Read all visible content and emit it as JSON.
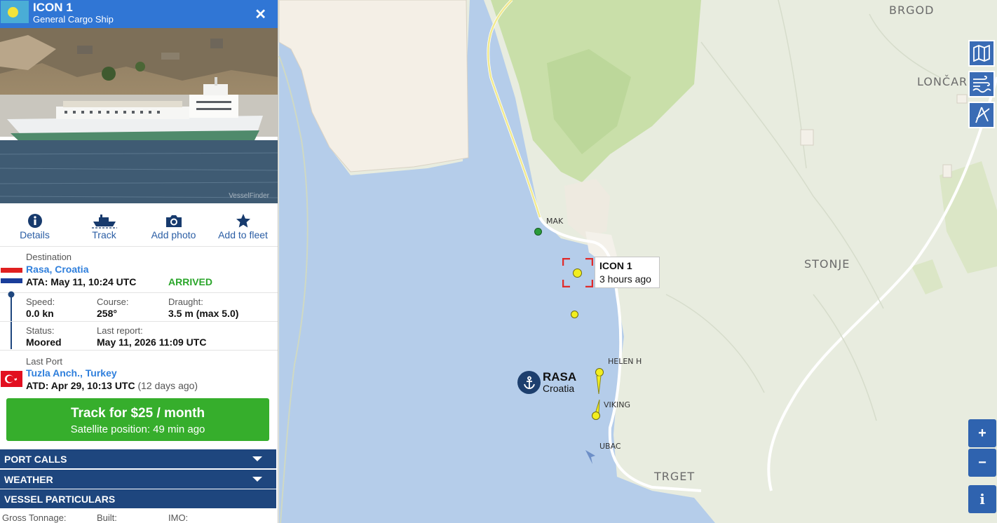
{
  "vessel": {
    "name": "ICON 1",
    "type": "General Cargo Ship",
    "photo_watermark": "VesselFinder",
    "close_glyph": "✕"
  },
  "actions": [
    {
      "label": "Details",
      "icon": "info-icon"
    },
    {
      "label": "Track",
      "icon": "ship-icon"
    },
    {
      "label": "Add photo",
      "icon": "camera-icon"
    },
    {
      "label": "Add to fleet",
      "icon": "star-icon"
    }
  ],
  "destination": {
    "label": "Destination",
    "port": "Rasa, Croatia",
    "ata": "ATA: May 11, 10:24 UTC",
    "status": "ARRIVED",
    "status_color": "#2aa52a"
  },
  "navigation": {
    "speed_label": "Speed:",
    "speed": "0.0 kn",
    "course_label": "Course:",
    "course": "258°",
    "draught_label": "Draught:",
    "draught": "3.5 m (max 5.0)",
    "status_label": "Status:",
    "status": "Moored",
    "report_label": "Last report:",
    "report": "May 11, 2026 11:09 UTC"
  },
  "last_port": {
    "label": "Last Port",
    "port": "Tuzla Anch., Turkey",
    "atd": "ATD: Apr 29, 10:13 UTC",
    "ago": "(12 days ago)"
  },
  "track_button": {
    "line1": "Track for $25 / month",
    "line2": "Satellite position: 49 min ago"
  },
  "sections": [
    {
      "label": "PORT CALLS"
    },
    {
      "label": "WEATHER"
    },
    {
      "label": "VESSEL PARTICULARS"
    }
  ],
  "particulars_headers": [
    "Gross Tonnage:",
    "Built:",
    "IMO:"
  ],
  "map": {
    "places": [
      "BRGOD",
      "LONČAR",
      "STONJE",
      "TRGET"
    ],
    "berths": [
      "MAK",
      "HELEN H",
      "VIKING",
      "UBAC"
    ],
    "tooltip_name": "ICON 1",
    "tooltip_time": "3 hours ago",
    "port_name": "RASA",
    "port_country": "Croatia",
    "zoom_in": "+",
    "zoom_out": "−",
    "info": "i",
    "colors": {
      "sea": "#b5cdea",
      "land": "#e8ecdf",
      "forest": "#c6dea6",
      "ship": "#f2ee1f"
    }
  }
}
